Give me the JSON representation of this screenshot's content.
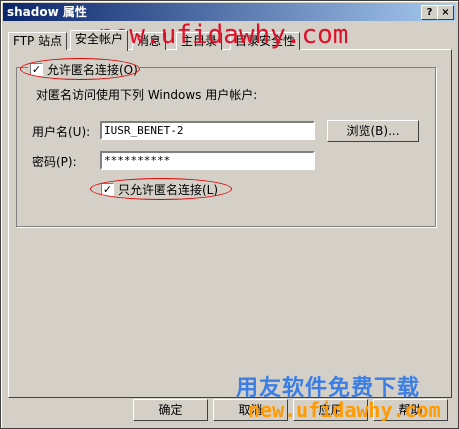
{
  "window": {
    "title": "shadow 属性",
    "help_glyph": "?",
    "close_glyph": "×"
  },
  "tabs": [
    {
      "label": "FTP 站点"
    },
    {
      "label": "安全帐户"
    },
    {
      "label": "消息"
    },
    {
      "label": "主目录"
    },
    {
      "label": "目录安全性"
    }
  ],
  "anon": {
    "checkbox_label": "允许匿名连接(O)",
    "checked": true,
    "description": "对匿名访问使用下列 Windows 用户帐户:",
    "username_label": "用户名(U):",
    "username_value": "IUSR_BENET-2",
    "browse_label": "浏览(B)...",
    "password_label": "密码(P):",
    "password_value": "**********",
    "only_anon_label": "只允许匿名连接(L)",
    "only_anon_checked": true
  },
  "buttons": {
    "ok": "确定",
    "cancel": "取消",
    "apply": "应用",
    "help": "帮助"
  },
  "watermarks": {
    "url_top": "new.ufidawhy.com",
    "brand": "用友软件免费下载",
    "url_bottom": "new.ufidawhy.com"
  },
  "colors": {
    "title_start": "#0a246a",
    "title_end": "#a6caf0",
    "annotation_red": "#e00000"
  }
}
